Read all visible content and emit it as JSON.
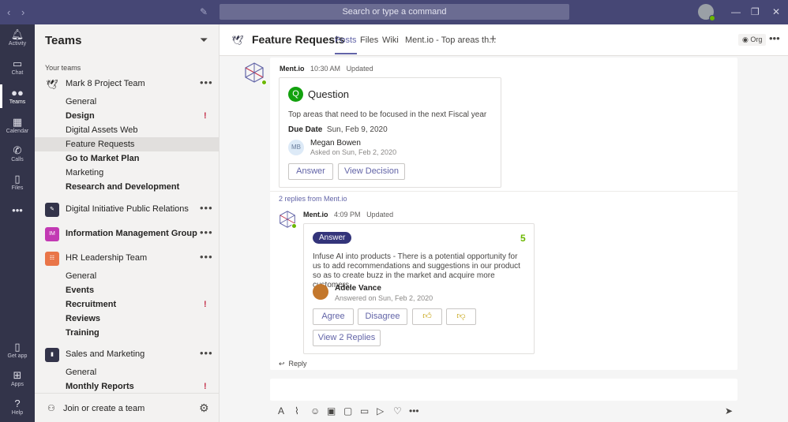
{
  "titlebar": {
    "search_placeholder": "Search or type a command"
  },
  "rail": {
    "items": [
      {
        "label": "Activity",
        "icon": "bell-icon"
      },
      {
        "label": "Chat",
        "icon": "chat-icon"
      },
      {
        "label": "Teams",
        "icon": "teams-icon"
      },
      {
        "label": "Calendar",
        "icon": "calendar-icon"
      },
      {
        "label": "Calls",
        "icon": "phone-icon"
      },
      {
        "label": "Files",
        "icon": "files-icon"
      }
    ],
    "bottom": [
      {
        "label": "Get app",
        "icon": "device-icon"
      },
      {
        "label": "Apps",
        "icon": "apps-icon"
      },
      {
        "label": "Help",
        "icon": "help-icon"
      }
    ]
  },
  "teams_panel": {
    "title": "Teams",
    "section": "Your teams",
    "teams": [
      {
        "name": "Mark 8 Project Team",
        "channels": [
          "General",
          "Design",
          "Digital Assets Web",
          "Feature Requests",
          "Go to Market Plan",
          "Marketing",
          "Research and Development"
        ]
      },
      {
        "name": "Digital Initiative Public Relations"
      },
      {
        "name": "Information Management Group",
        "initials": "IM"
      },
      {
        "name": "HR Leadership Team",
        "channels": [
          "General",
          "Events",
          "Recruitment",
          "Reviews",
          "Training"
        ]
      },
      {
        "name": "Sales and Marketing",
        "channels": [
          "General",
          "Monthly Reports"
        ]
      }
    ],
    "join_label": "Join or create a team"
  },
  "channel": {
    "title": "Feature Requests",
    "tabs": [
      "Posts",
      "Files",
      "Wiki",
      "Ment.io - Top areas th..."
    ],
    "org_label": "Org"
  },
  "post": {
    "author": "Ment.io",
    "time": "10:30 AM",
    "status": "Updated",
    "card": {
      "badge": "Q",
      "heading": "Question",
      "text": "Top areas that need to be focused in the next Fiscal year",
      "due_label": "Due Date",
      "due_value": "Sun, Feb 9, 2020",
      "asker_initials": "MB",
      "asker": "Megan Bowen",
      "asked_on": "Asked on Sun, Feb 2, 2020",
      "answer_btn": "Answer",
      "view_btn": "View Decision"
    },
    "replies_count": "2 replies from Ment.io",
    "reply": {
      "author": "Ment.io",
      "time": "4:09 PM",
      "status": "Updated",
      "pill": "Answer",
      "score": "5",
      "text": "Infuse AI into products - There is a potential opportunity for us to add recommendations and suggestions in our product so as to create buzz in the market and acquire more customers.",
      "answerer": "Adele Vance",
      "answered_on": "Answered on Sun, Feb 2, 2020",
      "agree": "Agree",
      "disagree": "Disagree",
      "view_replies": "View 2 Replies"
    },
    "reply_label": "Reply"
  }
}
